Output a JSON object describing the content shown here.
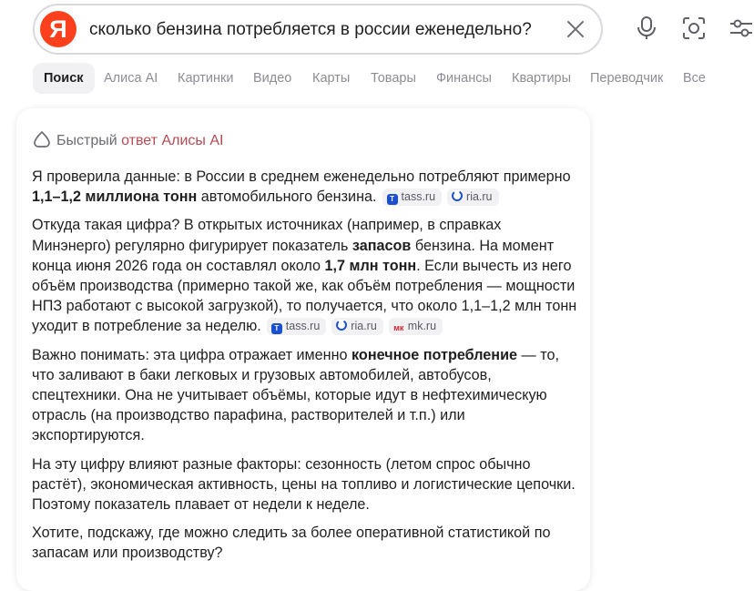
{
  "search": {
    "logo_letter": "Я",
    "query": "сколько бензина потребляется в россии еженедельно?"
  },
  "tabs": [
    {
      "label": "Поиск",
      "active": true
    },
    {
      "label": "Алиса AI"
    },
    {
      "label": "Картинки"
    },
    {
      "label": "Видео"
    },
    {
      "label": "Карты"
    },
    {
      "label": "Товары"
    },
    {
      "label": "Финансы"
    },
    {
      "label": "Квартиры"
    },
    {
      "label": "Переводчик"
    },
    {
      "label": "Все"
    }
  ],
  "card": {
    "header_prefix": "Быстрый ",
    "header_link": "ответ Алисы AI",
    "paragraphs": [
      {
        "t1": "Я проверила данные: в России в среднем еженедельно потребляют примерно ",
        "b1": "1,1–1,2 миллиона тонн",
        "t2": " автомобильного бензина.",
        "sources": [
          "tass.ru",
          "ria.ru"
        ]
      },
      {
        "t1": "Откуда такая цифра? В открытых источниках (например, в справках Минэнерго) регулярно фигурирует показатель ",
        "b1": "запасов",
        "t2": " бензина. На момент конца июня 2026 года он составлял около ",
        "b2": "1,7 млн тонн",
        "t3": ". Если вычесть из него объём производства (примерно такой же, как объём потребления — мощности НПЗ работают с высокой загрузкой), то получается, что около 1,1–1,2 млн тонн уходит в потребление за неделю.",
        "sources": [
          "tass.ru",
          "ria.ru",
          "mk.ru"
        ]
      },
      {
        "t1": "Важно понимать: эта цифра отражает именно ",
        "b1": "конечное потребление",
        "t2": " — то, что заливают в баки легковых и грузовых автомобилей, автобусов, спецтехники. Она не учитывает объёмы, которые идут в нефтехимическую отрасль (на производство парафина, растворителей и т.п.) или экспортируются."
      },
      {
        "t1": "На эту цифру влияют разные факторы: сезонность (летом спрос обычно растёт), экономическая активность, цены на топливо и логистические цепочки. Поэтому показатель плавает от недели к неделе."
      },
      {
        "t1": "Хотите, подскажу, где можно следить за более оперативной статистикой по запасам или производству?"
      }
    ]
  },
  "icons": {
    "clear": "close-icon",
    "voice": "microphone-icon",
    "camera": "camera-search-icon",
    "filters": "filter-sliders-icon",
    "alice": "alice-icon"
  },
  "colors": {
    "brand": "#fc3f1d",
    "alice_link": "#b44b53",
    "tab_active_bg": "#f1f1f4"
  }
}
